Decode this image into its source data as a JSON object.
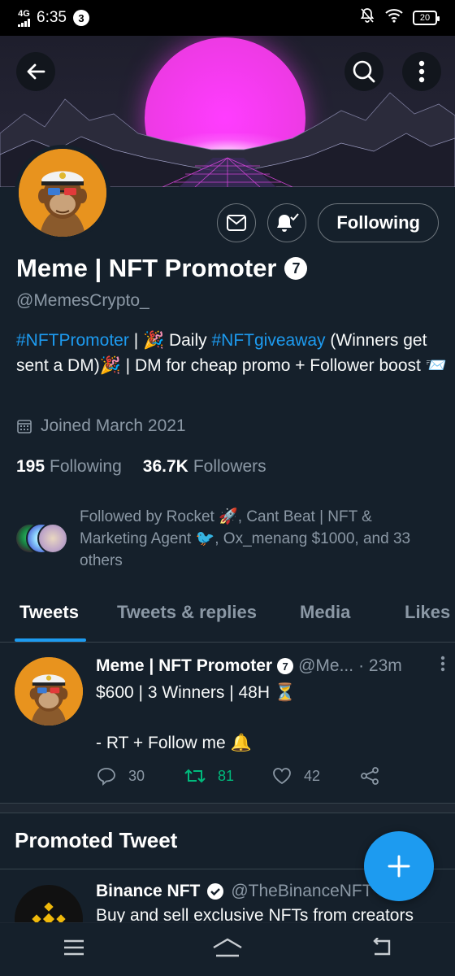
{
  "status_bar": {
    "network": "4G",
    "time": "6:35",
    "notification_count": "3",
    "battery": "20"
  },
  "profile": {
    "name": "Meme | NFT Promoter",
    "badge": "7",
    "handle": "@MemesCrypto_",
    "bio": {
      "hash1": "#NFTPromoter",
      "part1": " | 🎉 Daily ",
      "hash2": "#NFTgiveaway",
      "part2": " (Winners get sent a DM)🎉 | DM for cheap promo + Follower boost 📨"
    },
    "joined": "Joined March 2021",
    "following_count": "195",
    "following_label": "Following",
    "followers_count": "36.7K",
    "followers_label": "Followers",
    "followed_by": "Followed by Rocket 🚀, Cant Beat | NFT & Marketing Agent 🐦, Ox_menang $1000, and 33 others",
    "following_button": "Following"
  },
  "tabs": [
    "Tweets",
    "Tweets & replies",
    "Media",
    "Likes"
  ],
  "tweet": {
    "name": "Meme | NFT Promoter",
    "badge": "7",
    "handle": "@Me...",
    "time": "· 23m",
    "body": "$600  |  3 Winners  |  48H ⏳\n\n- RT + Follow me 🔔",
    "replies": "30",
    "retweets": "81",
    "likes": "42"
  },
  "promoted": {
    "title": "Promoted Tweet",
    "name": "Binance NFT",
    "handle": "@TheBinanceNFT",
    "body": "Buy and sell exclusive NFTs from creators"
  },
  "colors": {
    "background": "#15202b",
    "accent": "#1d9bf0",
    "retweet": "#00ba7c",
    "muted": "#8b98a5"
  }
}
